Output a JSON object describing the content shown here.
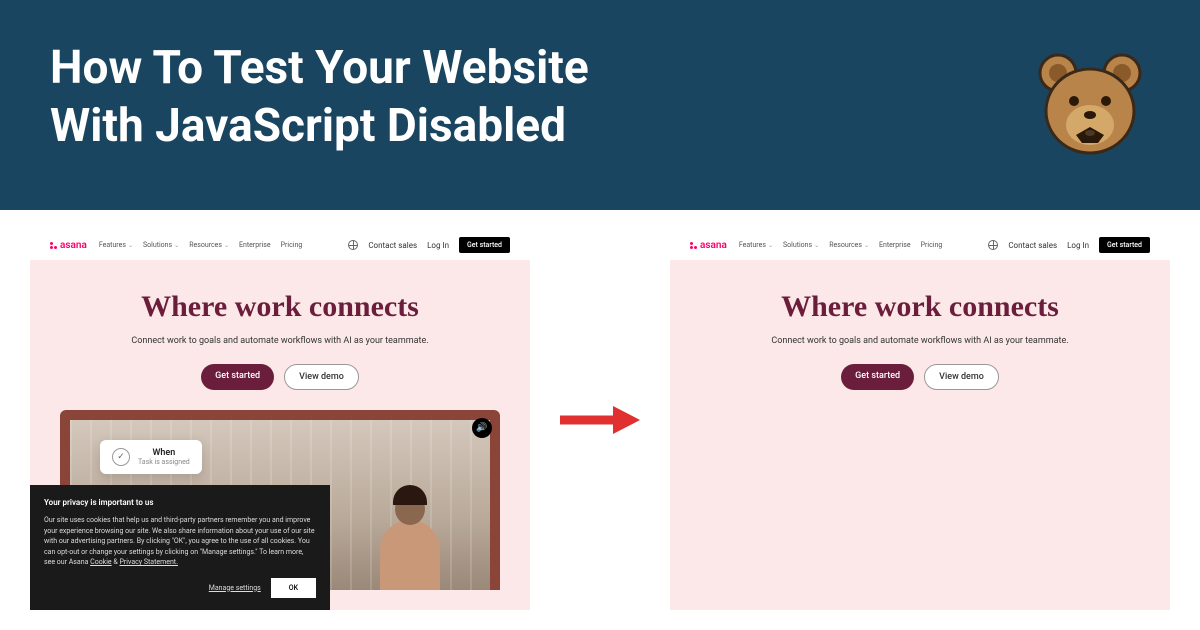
{
  "header": {
    "title_line1": "How To Test Your Website",
    "title_line2": "With JavaScript Disabled"
  },
  "nav": {
    "brand": "asana",
    "items": [
      {
        "label": "Features",
        "dropdown": true
      },
      {
        "label": "Solutions",
        "dropdown": true
      },
      {
        "label": "Resources",
        "dropdown": true
      },
      {
        "label": "Enterprise",
        "dropdown": false
      },
      {
        "label": "Pricing",
        "dropdown": false
      }
    ],
    "contact": "Contact sales",
    "login": "Log In",
    "cta": "Get started"
  },
  "hero": {
    "headline": "Where work connects",
    "subhead": "Connect work to goals and automate workflows with AI as your teammate.",
    "primary_btn": "Get started",
    "secondary_btn": "View demo"
  },
  "video_popup": {
    "title": "When",
    "subtitle": "Task is assigned"
  },
  "cookie": {
    "title": "Your privacy is important to us",
    "body": "Our site uses cookies that help us and third-party partners remember you and improve your experience browsing our site. We also share information about your use of our site with our advertising partners. By clicking \"OK\", you agree to the use of all cookies. You can opt-out or change your settings by clicking on \"Manage settings.\" To learn more, see our Asana ",
    "link1": "Cookie",
    "amp": " & ",
    "link2": "Privacy Statement.",
    "manage": "Manage settings",
    "ok": "OK"
  }
}
